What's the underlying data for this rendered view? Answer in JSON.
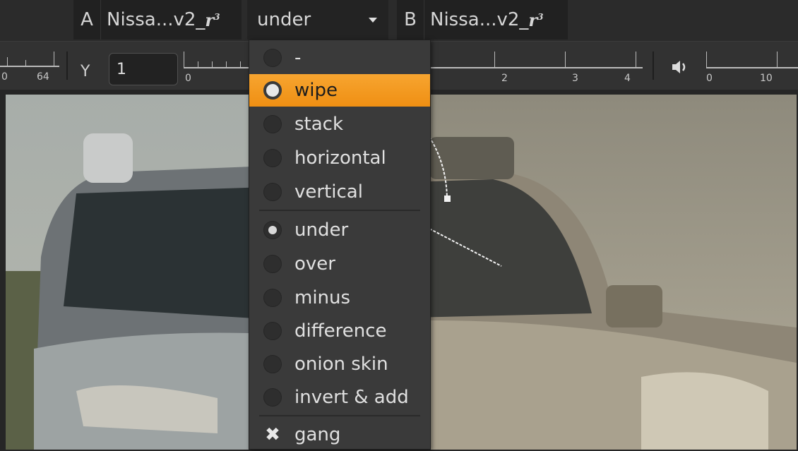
{
  "input_bar": {
    "a_letter": "A",
    "a_name": "Nissa...v2_",
    "a_mark": "r",
    "a_sup": "3",
    "mode_value": "under",
    "b_letter": "B",
    "b_name": "Nissa...v2_",
    "b_mark": "r",
    "b_sup": "3"
  },
  "toolbar": {
    "left_ticks": [
      "0",
      "64"
    ],
    "y_label": "Y",
    "y_value": "1",
    "ruler_ticks": [
      "0",
      "2",
      "3",
      "4"
    ],
    "audio_ticks": [
      "0",
      "10"
    ],
    "speaker_icon": "speaker-icon"
  },
  "menu": {
    "items": [
      {
        "label": "-",
        "state": "off"
      },
      {
        "label": "wipe",
        "state": "highlighted"
      },
      {
        "label": "stack",
        "state": "off"
      },
      {
        "label": "horizontal",
        "state": "off"
      },
      {
        "label": "vertical",
        "state": "off"
      },
      {
        "label": "under",
        "state": "checked"
      },
      {
        "label": "over",
        "state": "off"
      },
      {
        "label": "minus",
        "state": "off"
      },
      {
        "label": "difference",
        "state": "off"
      },
      {
        "label": "onion skin",
        "state": "off"
      },
      {
        "label": "invert & add",
        "state": "off"
      },
      {
        "label": "gang",
        "state": "checked-x"
      }
    ]
  },
  "colors": {
    "highlight": "#f39a1e",
    "menu_bg": "#3a3a3a",
    "bar_bg": "#2b2b2b"
  }
}
